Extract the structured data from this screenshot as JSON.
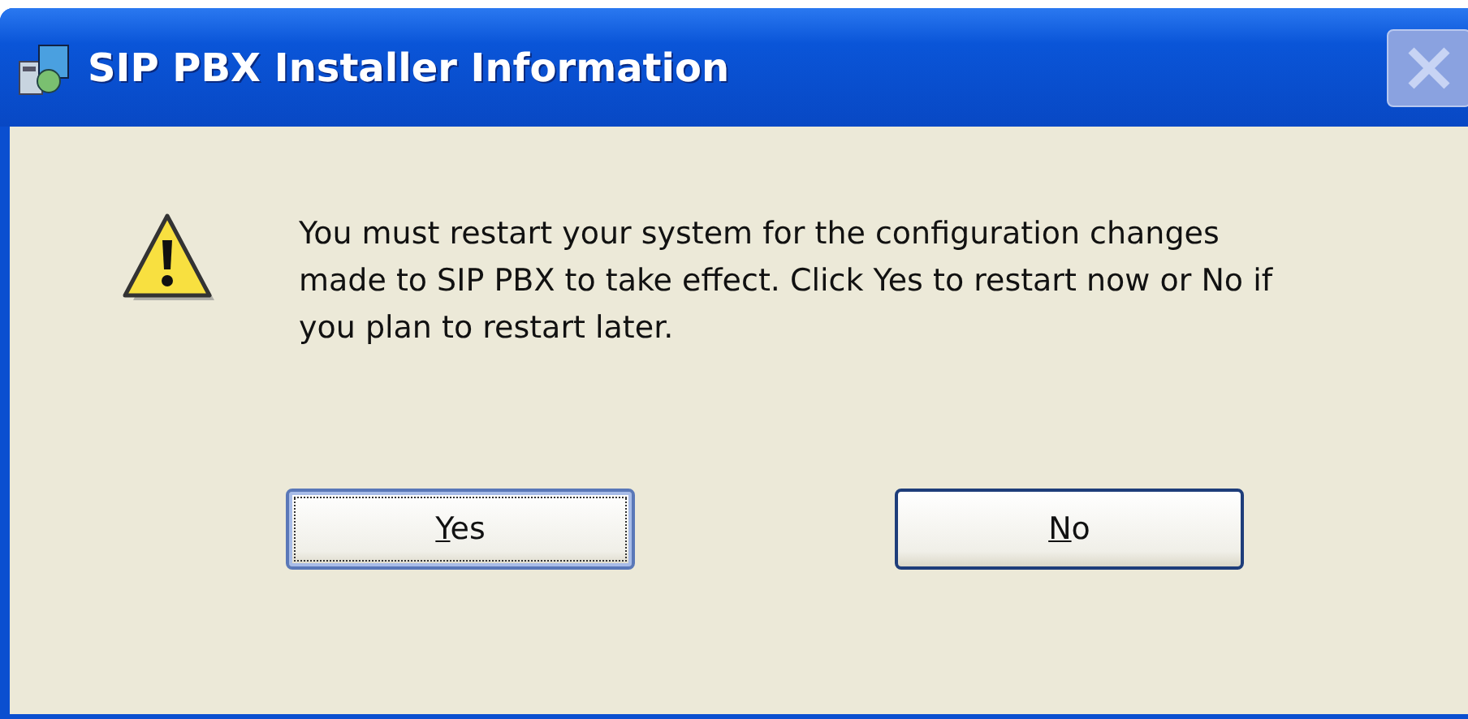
{
  "window": {
    "title": "SIP PBX Installer Information",
    "close_disabled": true
  },
  "message": "You must restart your system for the configuration changes made to SIP PBX to take effect. Click Yes to restart now or No if you plan to restart later.",
  "buttons": [
    {
      "label": "Yes",
      "focused": true,
      "underline_first": true
    },
    {
      "label": "No",
      "focused": false,
      "underline_first": true
    }
  ]
}
